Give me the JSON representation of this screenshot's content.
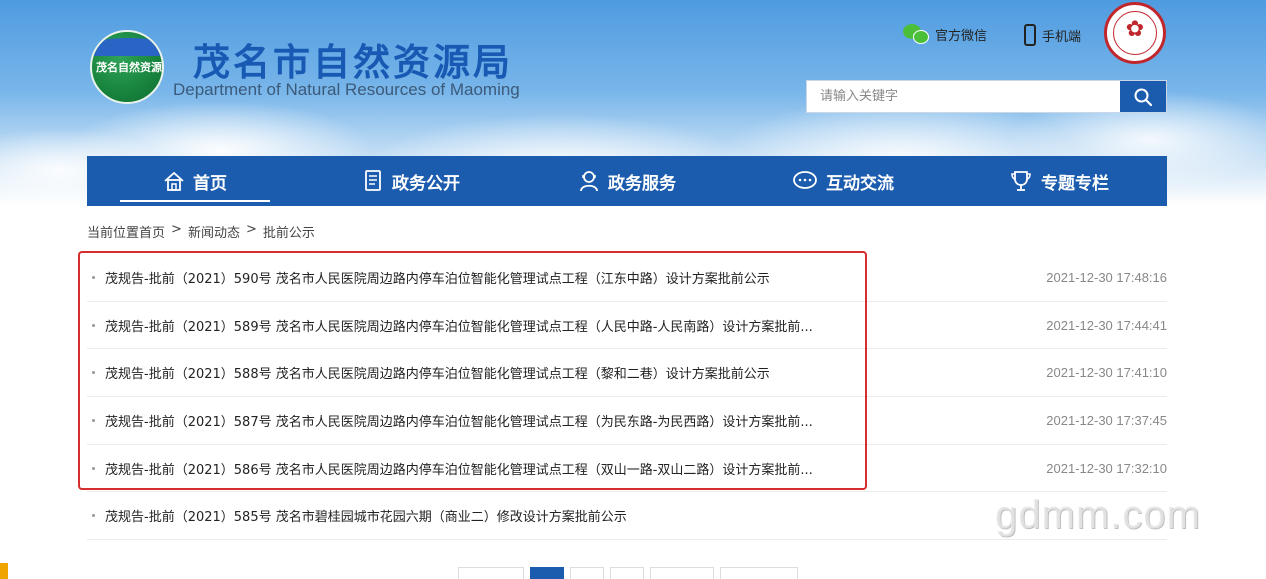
{
  "header": {
    "logo_text": "茂名自然资源",
    "title": "茂名市自然资源局",
    "subtitle": "Department of Natural Resources of Maoming",
    "links": [
      {
        "label": "官方微信",
        "icon": "wechat-icon"
      },
      {
        "label": "手机端",
        "icon": "mobile-phone-icon"
      }
    ],
    "badge_icon": "maoming-government-seal"
  },
  "search": {
    "placeholder": "请输入关键字",
    "button_icon": "search-icon"
  },
  "nav": {
    "items": [
      {
        "label": "首页",
        "icon": "home-icon",
        "active": true
      },
      {
        "label": "政务公开",
        "icon": "document-icon",
        "active": false
      },
      {
        "label": "政务服务",
        "icon": "user-service-icon",
        "active": false
      },
      {
        "label": "互动交流",
        "icon": "chat-icon",
        "active": false
      },
      {
        "label": "专题专栏",
        "icon": "trophy-icon",
        "active": false
      }
    ]
  },
  "breadcrumb": {
    "prefix": "当前位置",
    "items": [
      "首页",
      "新闻动态",
      "批前公示"
    ],
    "separator": ">"
  },
  "list": {
    "items": [
      {
        "title": "茂规告-批前（2021）590号 茂名市人民医院周边路内停车泊位智能化管理试点工程（江东中路）设计方案批前公示",
        "date": "2021-12-30 17:48:16"
      },
      {
        "title": "茂规告-批前（2021）589号 茂名市人民医院周边路内停车泊位智能化管理试点工程（人民中路-人民南路）设计方案批前...",
        "date": "2021-12-30 17:44:41"
      },
      {
        "title": "茂规告-批前（2021）588号 茂名市人民医院周边路内停车泊位智能化管理试点工程（黎和二巷）设计方案批前公示",
        "date": "2021-12-30 17:41:10"
      },
      {
        "title": "茂规告-批前（2021）587号 茂名市人民医院周边路内停车泊位智能化管理试点工程（为民东路-为民西路）设计方案批前...",
        "date": "2021-12-30 17:37:45"
      },
      {
        "title": "茂规告-批前（2021）586号 茂名市人民医院周边路内停车泊位智能化管理试点工程（双山一路-双山二路）设计方案批前...",
        "date": "2021-12-30 17:32:10"
      },
      {
        "title": "茂规告-批前（2021）585号 茂名市碧桂园城市花园六期（商业二）修改设计方案批前公示",
        "date": ""
      }
    ]
  },
  "watermark": "gdmm.com",
  "colors": {
    "brand_blue": "#1c5cae",
    "highlight_red": "#d62e2e"
  }
}
